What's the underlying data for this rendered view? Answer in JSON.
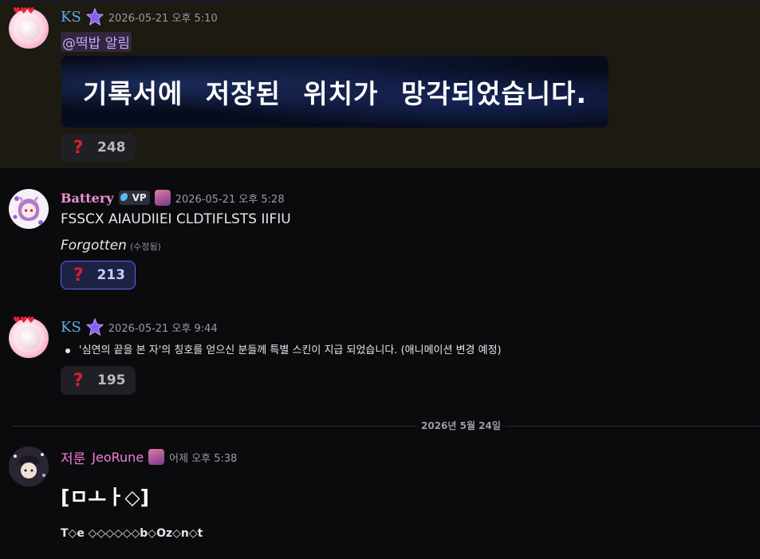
{
  "messages": [
    {
      "author": "KS",
      "timestamp": "2026-05-21 오후 5:10",
      "mention": "@떡밥 알림",
      "banner_text": "기록서에 저장된 위치가 망각되었습니다.",
      "reaction": {
        "emoji": "question-mark",
        "count": "248"
      }
    },
    {
      "author": "Battery",
      "badge": "VP",
      "timestamp": "2026-05-21 오후 5:28",
      "line1": "FSSCX AIAUDIIEI CLDTIFLSTS IIFIU",
      "line2": "Forgotten",
      "edited": "(수정됨)",
      "reaction": {
        "emoji": "question-mark",
        "count": "213",
        "active": true
      }
    },
    {
      "author": "KS",
      "timestamp": "2026-05-21 오후 9:44",
      "bullet": "'심연의 끝을 본 자'의 칭호를 얻으신 분들께 특별 스킨이 지급 되었습니다. (애니메이션 변경 예정)",
      "reaction": {
        "emoji": "question-mark",
        "count": "195"
      }
    },
    {
      "nickname": "저룬",
      "author": "JeoRune",
      "timestamp": "어제 오후 5:38",
      "big_text": "[ㅁㅗㅏ◇]",
      "small_text": "T◇e ◇◇◇◇◇◇b◇Oz◇n◇t"
    }
  ],
  "divider": "2026년 5월 24일",
  "colors": {
    "ks": "#5ea9e6",
    "battery": "#f08fd2",
    "jeorune": "#f080d6",
    "mention_bg": "#1c1a11",
    "reaction_active_border": "#5865f2"
  }
}
